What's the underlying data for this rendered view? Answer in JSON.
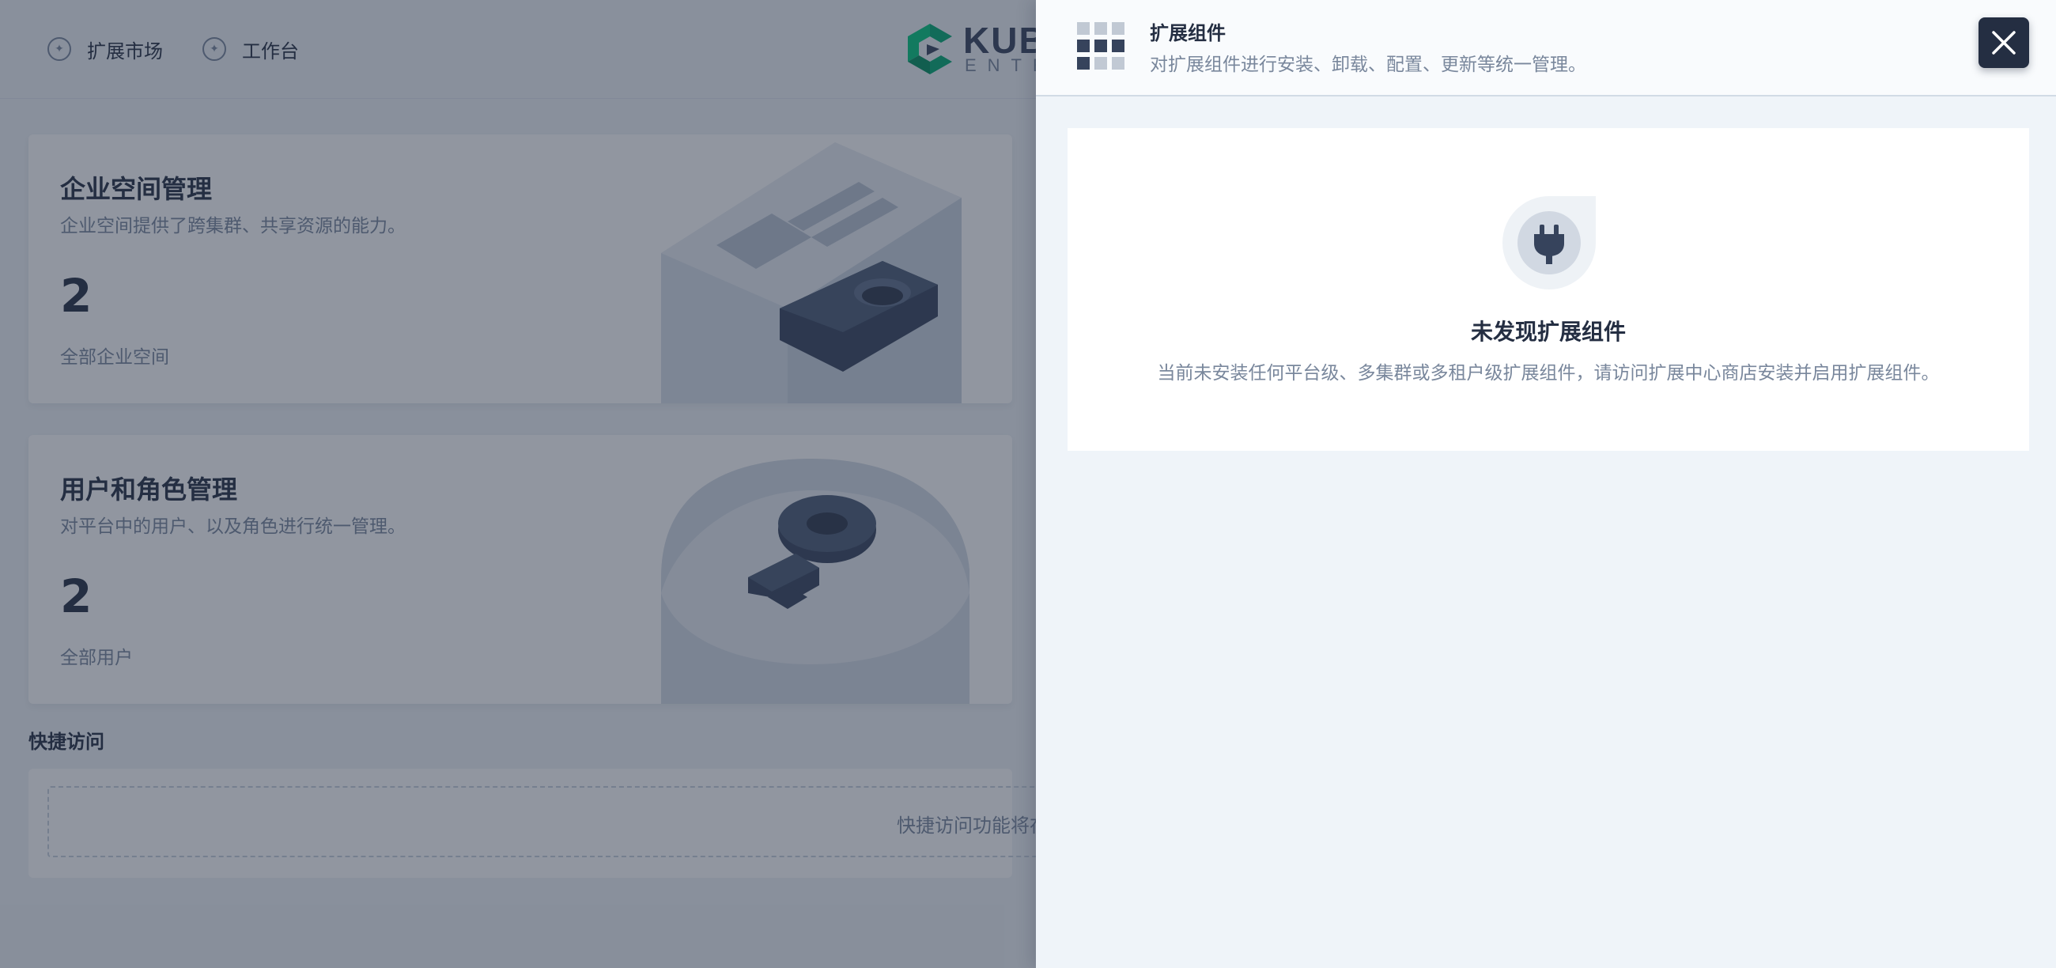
{
  "topbar": {
    "nav": [
      {
        "label": "扩展市场",
        "icon": "marketplace-icon"
      },
      {
        "label": "工作台",
        "icon": "workbench-icon"
      }
    ],
    "logo_text": "KUBES",
    "logo_sub": "ENTE"
  },
  "cards": [
    {
      "title": "企业空间管理",
      "description": "企业空间提供了跨集群、共享资源的能力。",
      "count": "2",
      "count_label": "全部企业空间",
      "illustration": "workspace-illustration"
    },
    {
      "title": "用户和角色管理",
      "description": "对平台中的用户、以及角色进行统一管理。",
      "count": "2",
      "count_label": "全部用户",
      "illustration": "user-key-illustration"
    }
  ],
  "quick_access": {
    "label": "快捷访问",
    "placeholder": "快捷访问功能将在"
  },
  "drawer": {
    "title": "扩展组件",
    "description": "对扩展组件进行安装、卸载、配置、更新等统一管理。",
    "close_icon": "close-icon",
    "empty_state": {
      "title": "未发现扩展组件",
      "description": "当前未安装任何平台级、多集群或多租户级扩展组件，请访问扩展中心商店安装并启用扩展组件。",
      "icon": "plug-icon"
    }
  },
  "colors": {
    "primary_text": "#242e42",
    "secondary_text": "#79879c",
    "drawer_bg": "#eff4f9",
    "overlay": "rgba(35,45,65,0.5)",
    "brand_green": "#00a971"
  }
}
